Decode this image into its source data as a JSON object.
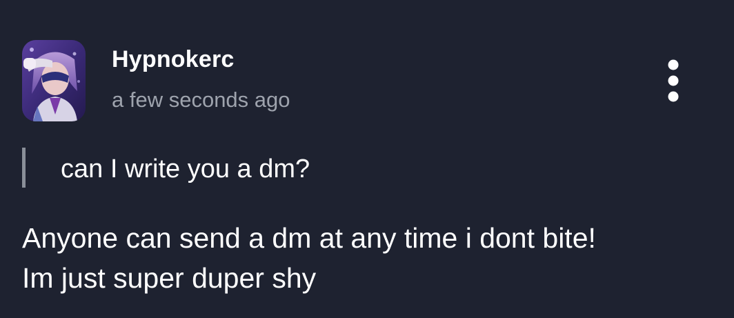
{
  "post": {
    "author": {
      "name": "Hypnokerc",
      "avatar_icon": "user-avatar-image"
    },
    "timestamp": "a few seconds ago",
    "menu_icon": "more-vertical-icon",
    "quote": "can I write you a dm?",
    "body_lines": [
      "Anyone can send a dm at any time i dont bite!",
      "Im just super duper shy"
    ]
  },
  "colors": {
    "background": "#1e2230",
    "text_primary": "#ffffff",
    "text_secondary": "#9ea3ad",
    "quote_bar": "#8a8f99"
  }
}
